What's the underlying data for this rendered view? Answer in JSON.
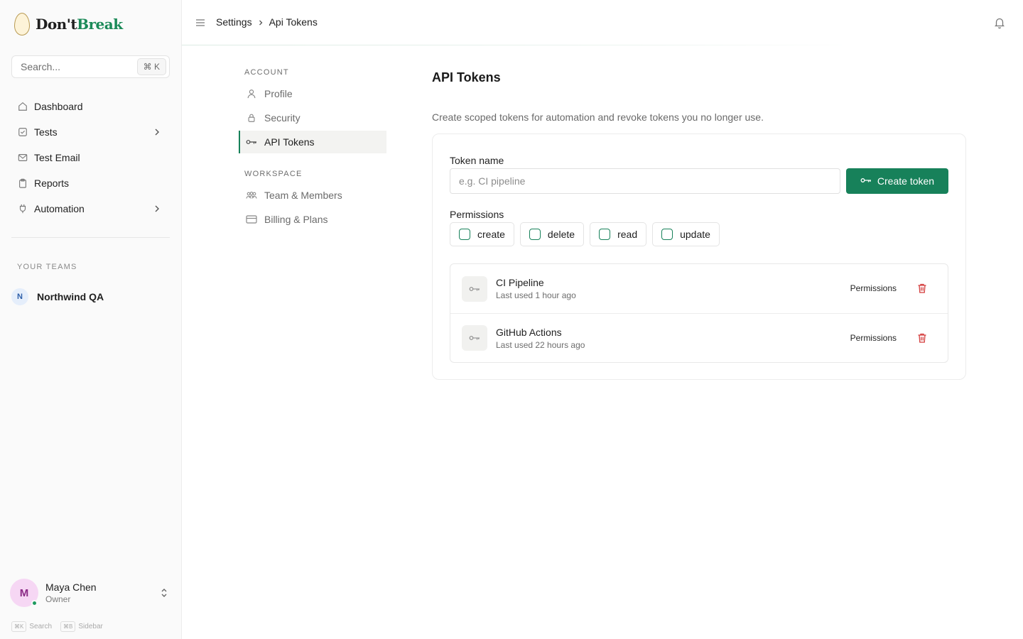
{
  "brand": {
    "part1": "Don't",
    "part2": "Break"
  },
  "search": {
    "placeholder": "Search...",
    "shortcut": "⌘ K"
  },
  "sidebar": {
    "items": [
      {
        "label": "Dashboard",
        "icon": "home-icon",
        "expandable": false
      },
      {
        "label": "Tests",
        "icon": "checkbox-icon",
        "expandable": true
      },
      {
        "label": "Test Email",
        "icon": "mail-icon",
        "expandable": false
      },
      {
        "label": "Reports",
        "icon": "clipboard-icon",
        "expandable": false
      },
      {
        "label": "Automation",
        "icon": "plug-icon",
        "expandable": true
      }
    ],
    "teams_label": "YOUR TEAMS",
    "team": {
      "initial": "N",
      "name": "Northwind QA"
    },
    "user": {
      "initial": "M",
      "name": "Maya Chen",
      "role": "Owner"
    },
    "hints": [
      {
        "key": "⌘K",
        "label": "Search"
      },
      {
        "key": "⌘B",
        "label": "Sidebar"
      }
    ]
  },
  "topbar": {
    "breadcrumb": [
      "Settings",
      "Api Tokens"
    ]
  },
  "settings_nav": {
    "account_label": "ACCOUNT",
    "account": [
      {
        "label": "Profile",
        "icon": "user-icon",
        "active": false
      },
      {
        "label": "Security",
        "icon": "lock-icon",
        "active": false
      },
      {
        "label": "API Tokens",
        "icon": "key-icon",
        "active": true
      }
    ],
    "workspace_label": "WORKSPACE",
    "workspace": [
      {
        "label": "Team & Members",
        "icon": "users-icon",
        "active": false
      },
      {
        "label": "Billing & Plans",
        "icon": "credit-card-icon",
        "active": false
      }
    ]
  },
  "main": {
    "title": "API Tokens",
    "description": "Create scoped tokens for automation and revoke tokens you no longer use.",
    "form": {
      "token_name_label": "Token name",
      "token_name_value": "",
      "token_name_placeholder": "e.g. CI pipeline",
      "create_label": "Create token",
      "permissions_label": "Permissions",
      "permissions": [
        {
          "label": "create",
          "checked": false
        },
        {
          "label": "delete",
          "checked": false
        },
        {
          "label": "read",
          "checked": false
        },
        {
          "label": "update",
          "checked": false
        }
      ]
    },
    "tokens": [
      {
        "name": "CI Pipeline",
        "last_used": "Last used 1 hour ago",
        "permissions_label": "Permissions"
      },
      {
        "name": "GitHub Actions",
        "last_used": "Last used 22 hours ago",
        "permissions_label": "Permissions"
      }
    ]
  },
  "colors": {
    "accent": "#17815a",
    "danger": "#d33a3a",
    "sidebar_bg": "#fafafa"
  }
}
